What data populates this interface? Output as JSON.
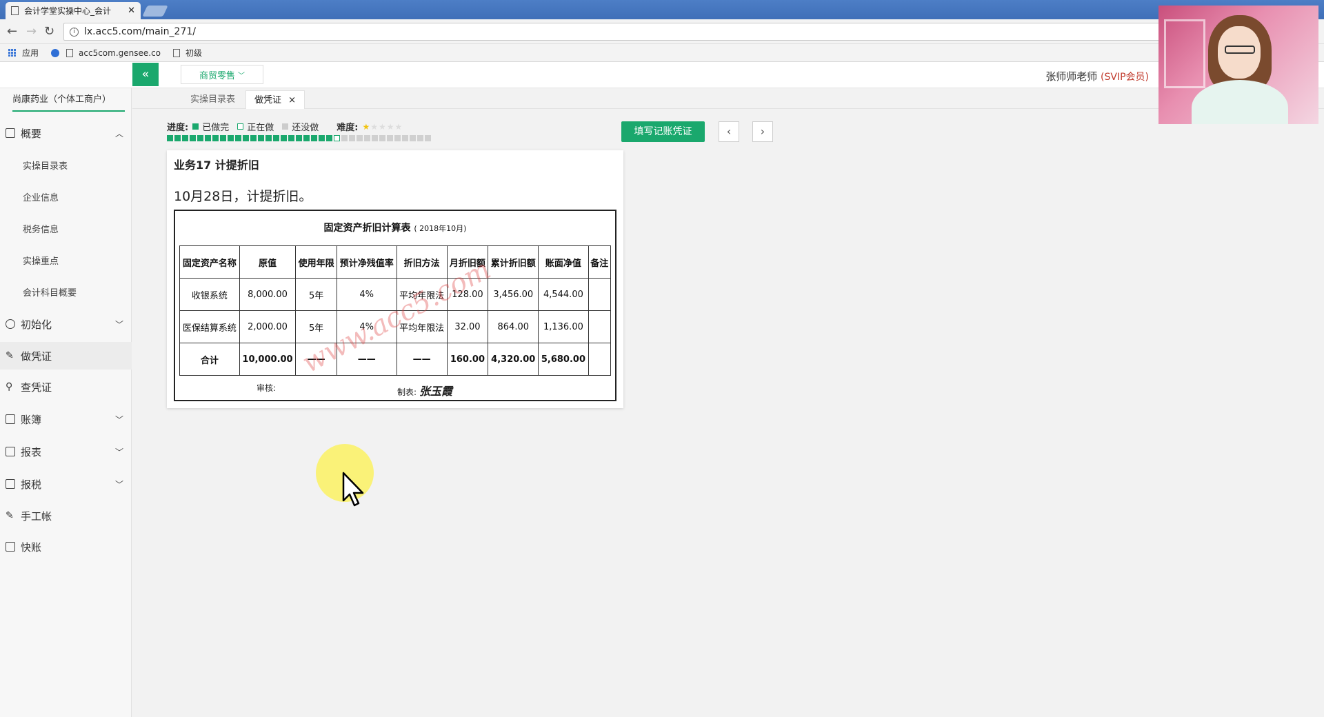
{
  "browser": {
    "tab_title": "会计学堂实操中心_会计",
    "url": "lx.acc5.com/main_271/",
    "bookmarks": [
      {
        "label": "应用",
        "icon": "apps-icon"
      },
      {
        "label": "acc5com.gensee.co",
        "icon": "paw-icon"
      },
      {
        "label": "初级",
        "icon": "page-icon"
      }
    ]
  },
  "header": {
    "industry": "商贸零售",
    "user": "张师师老师",
    "member": "(SVIP会员)"
  },
  "sidebar": {
    "company": "尚康药业（个体工商户）",
    "overview": "概要",
    "sub_items": [
      "实操目录表",
      "企业信息",
      "税务信息",
      "实操重点",
      "会计科目概要"
    ],
    "init": "初始化",
    "voucher": "做凭证",
    "query": "查凭证",
    "books": "账簿",
    "reports": "报表",
    "tax": "报税",
    "manual": "手工帐",
    "quick": "快账"
  },
  "tabs": {
    "catalog": "实操目录表",
    "voucher": "做凭证",
    "close": "×"
  },
  "progress": {
    "label": "进度:",
    "done": "已做完",
    "doing": "正在做",
    "todo": "还没做",
    "difficulty_label": "难度:",
    "difficulty_stars": 1,
    "difficulty_max": 5,
    "completed_count": 22,
    "current_index": 23,
    "total_count": 35
  },
  "actions": {
    "fill_voucher": "填写记账凭证",
    "prev": "‹",
    "next": "›"
  },
  "task": {
    "title": "业务17 计提折旧",
    "desc": "10月28日，计提折旧。",
    "sheet_title": "固定资产折旧计算表",
    "sheet_period": "( 2018年10月)",
    "headers": [
      "固定资产名称",
      "原值",
      "使用年限",
      "预计净残值率",
      "折旧方法",
      "月折旧额",
      "累计折旧额",
      "账面净值",
      "备注"
    ],
    "rows": [
      [
        "收银系统",
        "8,000.00",
        "5年",
        "4%",
        "平均年限法",
        "128.00",
        "3,456.00",
        "4,544.00",
        ""
      ],
      [
        "医保结算系统",
        "2,000.00",
        "5年",
        "4%",
        "平均年限法",
        "32.00",
        "864.00",
        "1,136.00",
        ""
      ]
    ],
    "total": [
      "合计",
      "10,000.00",
      "——",
      "——",
      "——",
      "160.00",
      "4,320.00",
      "5,680.00",
      ""
    ],
    "audit": "审核:",
    "maker": "制表:",
    "signature": "张玉霞",
    "watermark": "www.acc5.com"
  }
}
